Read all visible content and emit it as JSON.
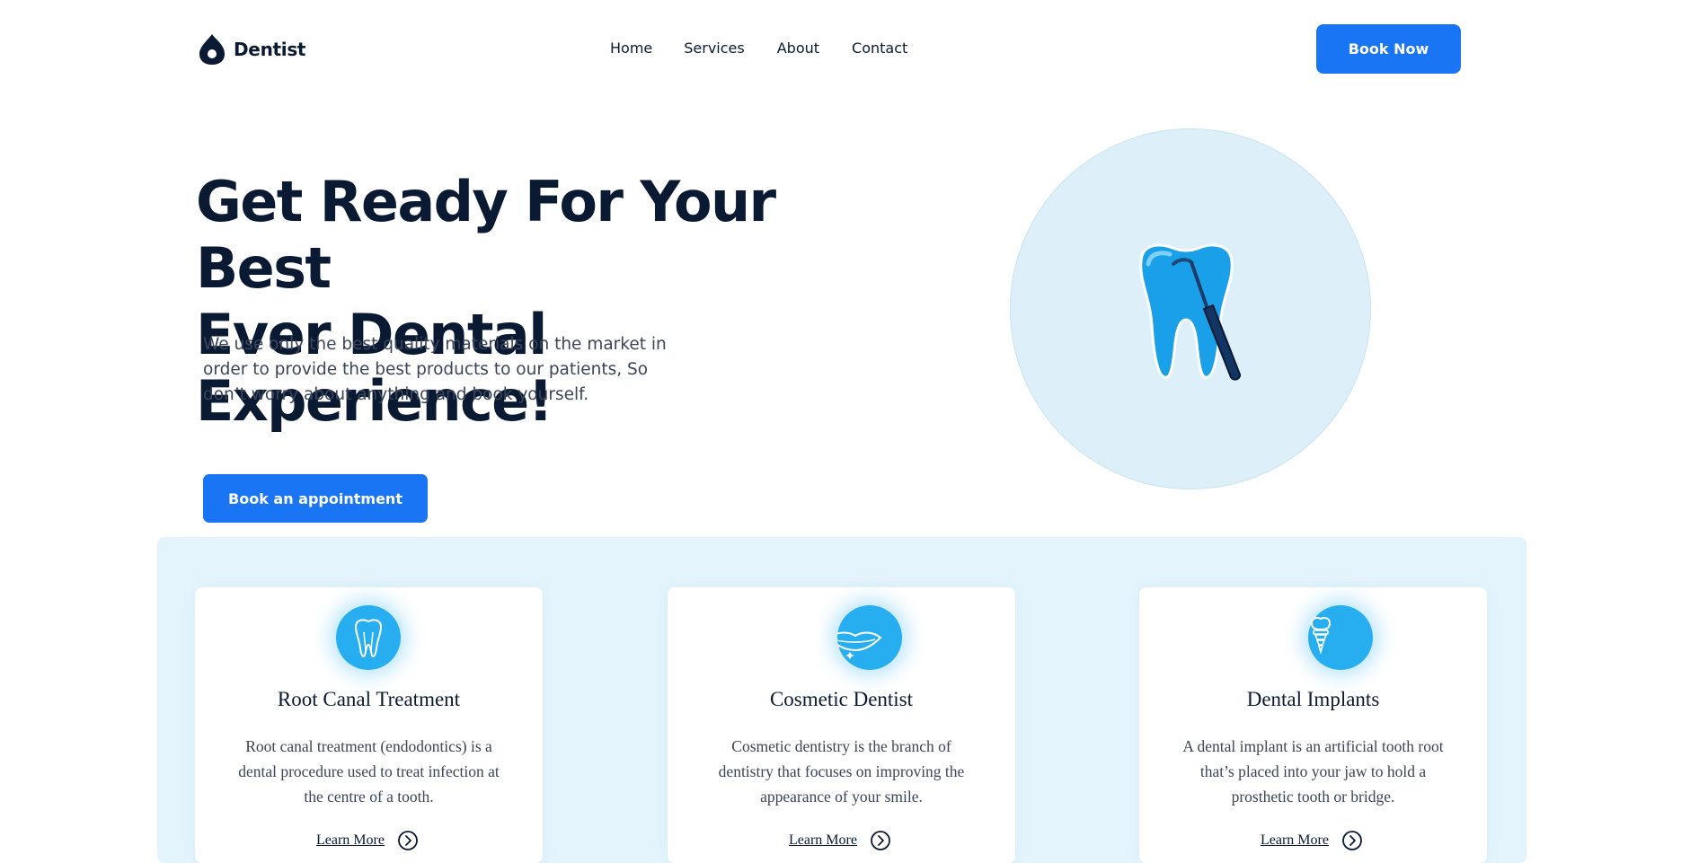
{
  "header": {
    "brand": "Dentist",
    "logo_icon": "tooth-drop-icon",
    "nav": [
      {
        "label": "Home"
      },
      {
        "label": "Services"
      },
      {
        "label": "About"
      },
      {
        "label": "Contact"
      }
    ],
    "cta_label": "Book Now"
  },
  "hero": {
    "title_line1": "Get Ready For Your Best",
    "title_line2": "Ever Dental Experience!",
    "desc_line1": "We use only the best quality materials on the market in",
    "desc_line2": "order to provide the best products to our patients, So",
    "desc_line3": "don’t worry about anything and book yourself.",
    "cta_label": "Book an appointment",
    "illustration_icon": "tooth-with-dental-tool-icon"
  },
  "services": [
    {
      "icon": "tooth-outline-icon",
      "title": "Root Canal Treatment",
      "text": [
        "Root canal treatment (endodontics) is a",
        "dental procedure used to treat infection at",
        "the centre of a tooth."
      ],
      "link": "Learn More"
    },
    {
      "icon": "smile-lips-icon",
      "title": "Cosmetic Dentist",
      "text": [
        "Cosmetic dentistry is the branch of",
        "dentistry that focuses on improving the",
        "appearance of your smile."
      ],
      "link": "Learn More"
    },
    {
      "icon": "dental-implant-icon",
      "title": "Dental Implants",
      "text": [
        "A dental implant is an artificial tooth root",
        "that’s placed into your jaw to hold a",
        "prosthetic tooth or bridge."
      ],
      "link": "Learn More"
    }
  ],
  "colors": {
    "primary": "#1a75f5",
    "dark": "#0b1a33",
    "light_blue_bg": "#e3f4fc",
    "icon_blue": "#27aef0"
  }
}
